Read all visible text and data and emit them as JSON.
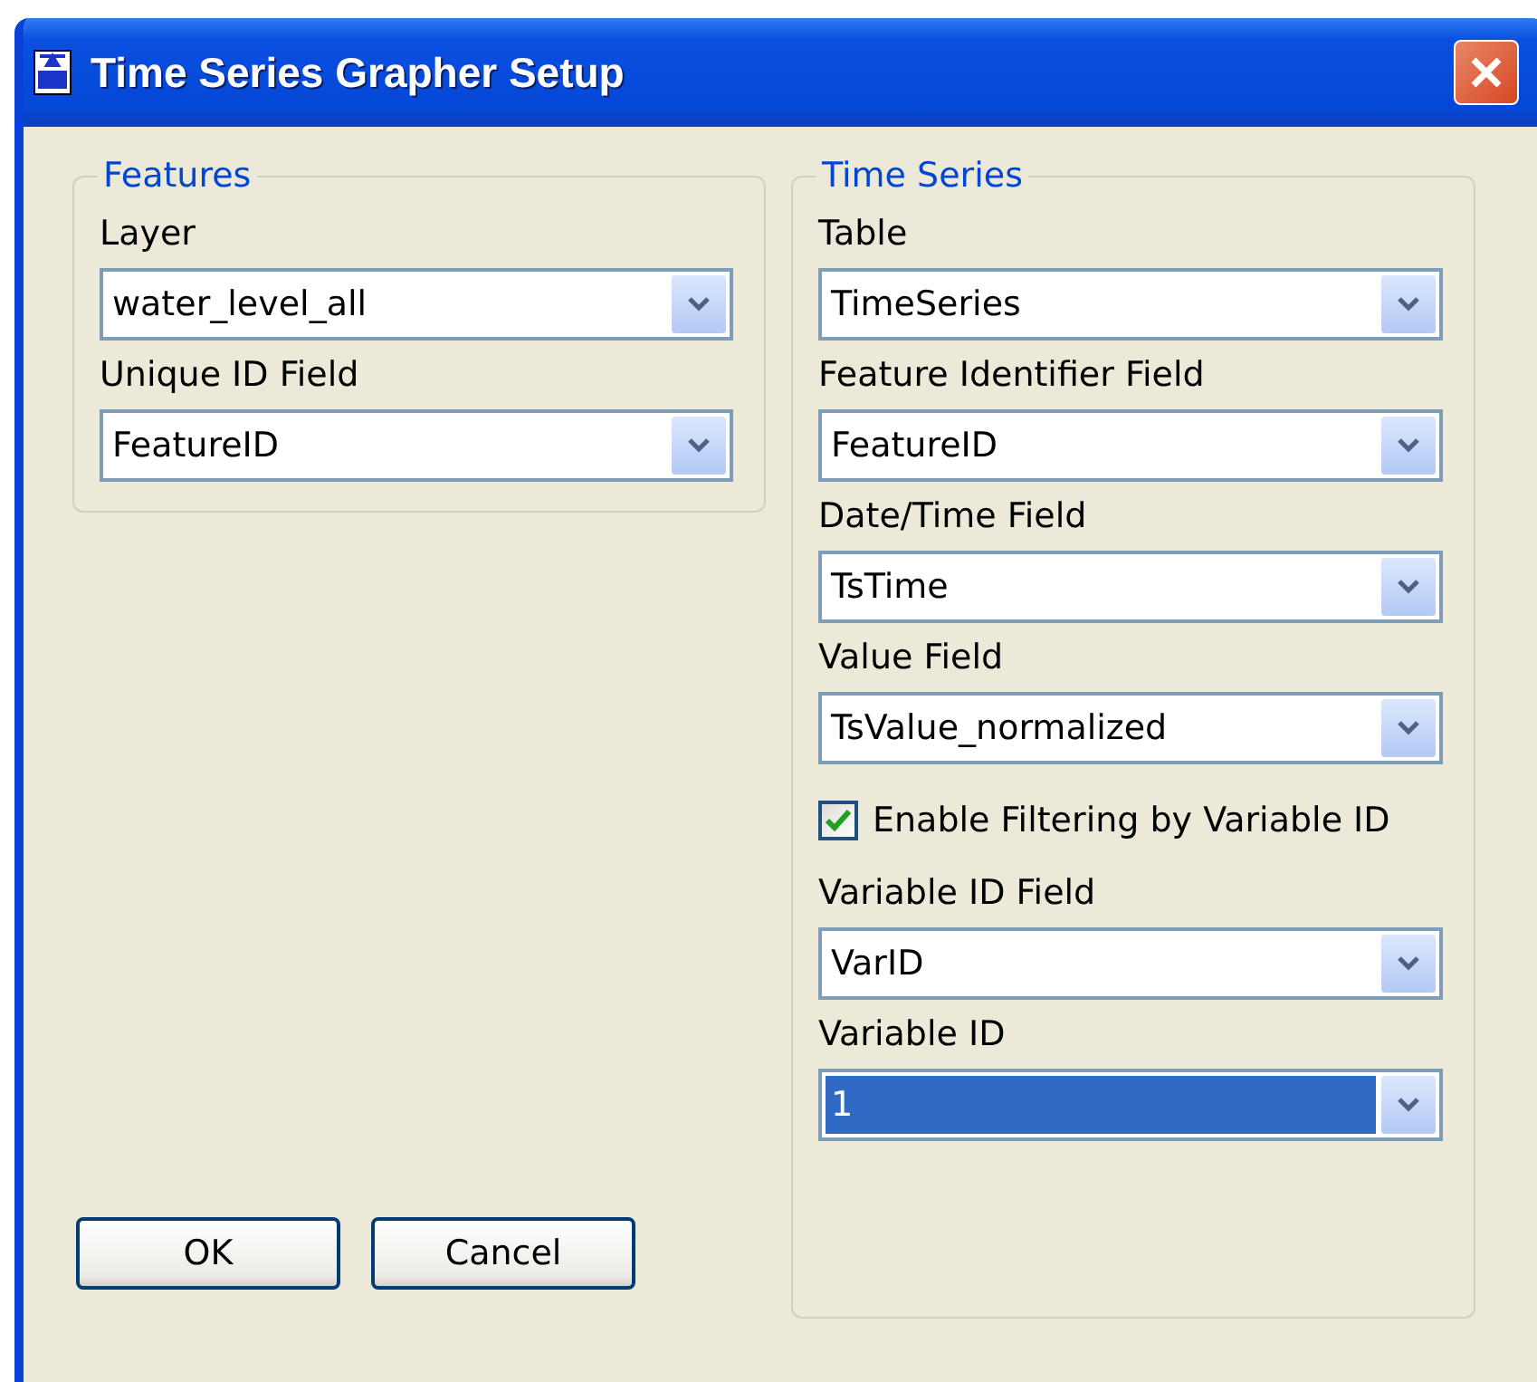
{
  "window": {
    "title": "Time Series Grapher Setup"
  },
  "features": {
    "title": "Features",
    "items": [
      {
        "kind": "combo",
        "label": "Layer",
        "value": "water_level_all",
        "highlighted": false
      },
      {
        "kind": "combo",
        "label": "Unique ID Field",
        "value": "FeatureID",
        "highlighted": false
      }
    ]
  },
  "time_series": {
    "title": "Time Series",
    "items": [
      {
        "kind": "combo",
        "label": "Table",
        "value": "TimeSeries",
        "highlighted": false
      },
      {
        "kind": "combo",
        "label": "Feature Identifier Field",
        "value": "FeatureID",
        "highlighted": false
      },
      {
        "kind": "combo",
        "label": "Date/Time Field",
        "value": "TsTime",
        "highlighted": false
      },
      {
        "kind": "combo",
        "label": "Value Field",
        "value": "TsValue_normalized",
        "highlighted": false
      },
      {
        "kind": "checkbox",
        "label": "Enable Filtering by Variable ID",
        "checked": true
      },
      {
        "kind": "combo",
        "label": "Variable ID Field",
        "value": "VarID",
        "highlighted": false
      },
      {
        "kind": "combo",
        "label": "Variable ID",
        "value": "1",
        "highlighted": true
      }
    ]
  },
  "buttons": [
    "OK",
    "Cancel"
  ]
}
